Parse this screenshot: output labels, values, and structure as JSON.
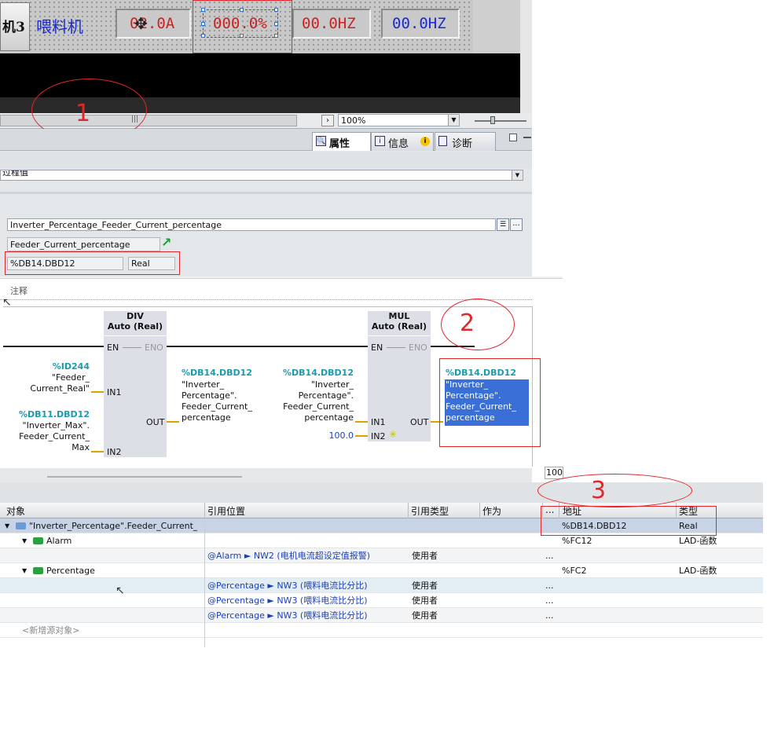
{
  "hmi": {
    "machine_label": "机3",
    "feeder_label": "喂料机",
    "current_value": "02.0A",
    "percent_value": "000.0%",
    "freq1_value": "00.0HZ",
    "freq2_value": "00.0HZ",
    "scroll_marker": "|||",
    "zoom_value": "100%",
    "annotation1": "1"
  },
  "inspector": {
    "tabs": [
      {
        "label": "属性",
        "icon": "properties-icon"
      },
      {
        "label": "信息",
        "icon": "info-icon"
      },
      {
        "label": "诊断",
        "icon": "diagnostics-icon"
      }
    ],
    "process_value_label": "过程值",
    "tag_field": "Inverter_Percentage_Feeder_Current_percentage",
    "tag_name": "Feeder_Current_percentage",
    "address": "%DB14.DBD12",
    "data_type": "Real"
  },
  "ladder": {
    "comment_label": "注释",
    "annotation2": "2",
    "div_block": {
      "title": "DIV",
      "subtitle": "Auto (Real)",
      "en": "EN",
      "eno": "ENO",
      "in1": "IN1",
      "in2": "IN2",
      "out": "OUT",
      "in1_addr": "%ID244",
      "in1_name": "\"Feeder_ Current_Real\"",
      "in2_addr": "%DB11.DBD12",
      "in2_name": "\"Inverter_Max\". Feeder_Current_ Max",
      "out_addr": "%DB14.DBD12",
      "out_name": "\"Inverter_ Percentage\". Feeder_Current_ percentage"
    },
    "mul_block": {
      "title": "MUL",
      "subtitle": "Auto (Real)",
      "en": "EN",
      "eno": "ENO",
      "in1": "IN1",
      "in2": "IN2",
      "out": "OUT",
      "in1_addr": "%DB14.DBD12",
      "in1_name": "\"Inverter_ Percentage\". Feeder_Current_ percentage",
      "in2_value": "100.0",
      "out_addr": "%DB14.DBD12",
      "out_name": "\"Inverter_ Percentage\". Feeder_Current_ percentage"
    },
    "zoom_tip": "100"
  },
  "xref": {
    "annotation3": "3",
    "columns": [
      "对象",
      "引用位置",
      "引用类型",
      "作为",
      "...",
      "地址",
      "类型"
    ],
    "rows": [
      {
        "object": "\"Inverter_Percentage\".Feeder_Current_",
        "location": "",
        "ref_type": "",
        "as": "",
        "dots": "",
        "address": "%DB14.DBD12",
        "type": "Real",
        "level": 0,
        "icon": "db-tag-icon",
        "expand": "▼"
      },
      {
        "object": "Alarm",
        "location": "",
        "ref_type": "",
        "as": "",
        "dots": "",
        "address": "%FC12",
        "type": "LAD-函数",
        "level": 1,
        "icon": "function-block-icon",
        "expand": "▼"
      },
      {
        "object": "",
        "location": "@Alarm ► NW2 (电机电流超设定值报警)",
        "ref_type": "使用者",
        "as": "",
        "dots": "...",
        "address": "",
        "type": "",
        "level": 2,
        "icon": "",
        "expand": ""
      },
      {
        "object": "Percentage",
        "location": "",
        "ref_type": "",
        "as": "",
        "dots": "",
        "address": "%FC2",
        "type": "LAD-函数",
        "level": 1,
        "icon": "function-block-icon",
        "expand": "▼"
      },
      {
        "object": "",
        "location": "@Percentage ► NW3 (喂料电流比分比)",
        "ref_type": "使用者",
        "as": "",
        "dots": "...",
        "address": "",
        "type": "",
        "level": 2,
        "icon": "",
        "expand": ""
      },
      {
        "object": "",
        "location": "@Percentage ► NW3 (喂料电流比分比)",
        "ref_type": "使用者",
        "as": "",
        "dots": "...",
        "address": "",
        "type": "",
        "level": 2,
        "icon": "",
        "expand": ""
      },
      {
        "object": "",
        "location": "@Percentage ► NW3 (喂料电流比分比)",
        "ref_type": "使用者",
        "as": "",
        "dots": "...",
        "address": "",
        "type": "",
        "level": 2,
        "icon": "",
        "expand": ""
      },
      {
        "object": "<新增源对象>",
        "location": "",
        "ref_type": "",
        "as": "",
        "dots": "",
        "address": "",
        "type": "",
        "level": 0,
        "icon": "",
        "expand": ""
      }
    ]
  },
  "colors": {
    "annotation_red": "#e3262c",
    "hmi_red": "#cc2222",
    "hmi_blue": "#1a2acc",
    "selection_blue": "#3a6fd8",
    "tag_cyan": "#1a9ab0"
  }
}
